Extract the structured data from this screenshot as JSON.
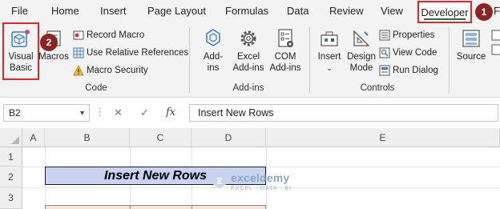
{
  "menu": {
    "items": [
      "File",
      "Home",
      "Insert",
      "Page Layout",
      "Formulas",
      "Data",
      "Review",
      "View"
    ],
    "active": "Developer",
    "partial_next": "F"
  },
  "steps": {
    "one": "1",
    "two": "2"
  },
  "ribbon": {
    "code": {
      "label": "Code",
      "visual_basic_line1": "Visual",
      "visual_basic_line2": "Basic",
      "macros": "Macros",
      "record_macro": "Record Macro",
      "relative_refs": "Use Relative References",
      "macro_security": "Macro Security"
    },
    "addins": {
      "label": "Add-ins",
      "addins_line1": "Add-",
      "addins_line2": "ins",
      "excel_line1": "Excel",
      "excel_line2": "Add-ins",
      "com_line1": "COM",
      "com_line2": "Add-ins"
    },
    "controls": {
      "label": "Controls",
      "insert": "Insert",
      "design_line1": "Design",
      "design_line2": "Mode",
      "properties": "Properties",
      "view_code": "View Code",
      "run_dialog": "Run Dialog"
    },
    "xml": {
      "source": "Source"
    }
  },
  "formula_bar": {
    "name_box": "B2",
    "cancel_symbol": "✕",
    "enter_symbol": "✓",
    "fx_symbol": "fx",
    "formula": "Insert New Rows"
  },
  "sheet": {
    "columns": [
      "A",
      "B",
      "C",
      "D",
      "E"
    ],
    "rows": [
      "1",
      "2",
      "3"
    ],
    "title_cell": "Insert New Rows"
  },
  "watermark": {
    "name": "exceldemy",
    "tagline": "EXCEL · DATA · BI"
  },
  "colors": {
    "highlight_red": "#e3262a",
    "badge": "#8b2424",
    "accent_green": "#217346",
    "title_fill": "#c9d3f2",
    "table_header_fill": "#fbe2d5"
  }
}
